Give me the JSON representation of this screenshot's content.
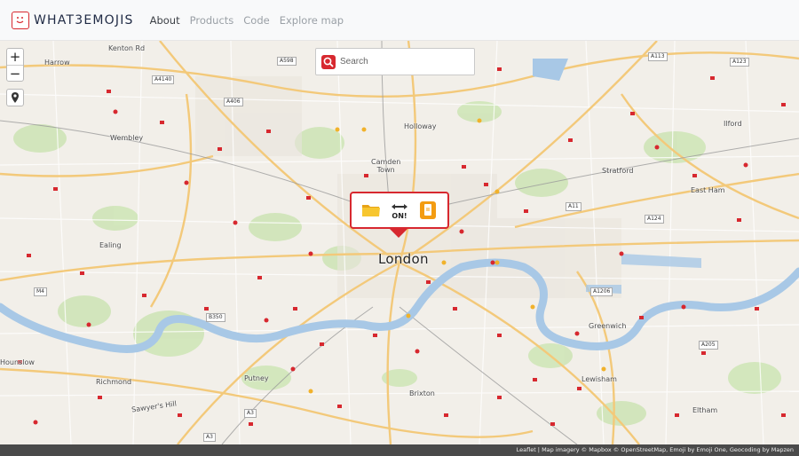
{
  "brand": {
    "name": "WHAT3EMOJIS"
  },
  "nav": [
    {
      "label": "About",
      "active": true
    },
    {
      "label": "Products",
      "active": false
    },
    {
      "label": "Code",
      "active": false
    },
    {
      "label": "Explore map",
      "active": false
    }
  ],
  "search": {
    "placeholder": "Search"
  },
  "zoom": {
    "in": "+",
    "out": "−"
  },
  "popup": {
    "emojis": [
      "file-folder-icon",
      "on-arrow-icon",
      "mobile-phone-icon"
    ]
  },
  "map": {
    "places": {
      "london": "London",
      "kenton": "Kenton Rd",
      "harrow": "Harrow",
      "wembley": "Wembley",
      "ealing": "Ealing",
      "hounslow": "Hounslow",
      "richmond": "Richmond",
      "sawyers": "Sawyer's Hill",
      "putney": "Putney",
      "brixton": "Brixton",
      "lewisham": "Lewisham",
      "greenwich": "Greenwich",
      "eltham": "Eltham",
      "camden": "Camden\nTown",
      "holloway": "Holloway",
      "stratford": "Stratford",
      "eastham": "East Ham",
      "ilford": "Ilford"
    },
    "roads": [
      "A598",
      "A113",
      "A123",
      "A4140",
      "A406",
      "A11",
      "A124",
      "A1206",
      "M4",
      "B350",
      "A205",
      "A3",
      "A3"
    ]
  },
  "attribution": "Leaflet | Map imagery © Mapbox © OpenStreetMap, Emoji by Emoji One, Geocoding by Mapzen",
  "colors": {
    "accent": "#d7282f",
    "water": "#a8c8e6",
    "park": "#cfe5b8",
    "road": "#f3c97a"
  }
}
